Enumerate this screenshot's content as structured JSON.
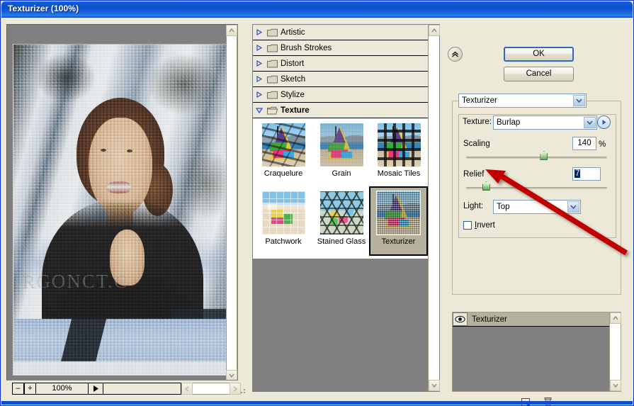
{
  "window": {
    "title": "Texturizer (100%)"
  },
  "preview": {
    "zoom_label": "100%",
    "zoom_out_label": "–",
    "zoom_in_label": "+",
    "watermark": "RGONCT.C",
    "scroll_up_icon": "chevron-up-icon",
    "scroll_down_icon": "chevron-down-icon",
    "scroll_left_icon": "chevron-left-icon",
    "scroll_right_icon": "chevron-right-icon",
    "preview_toggle_icon": "play-triangle-icon"
  },
  "filter_list": {
    "categories": [
      {
        "label": "Artistic",
        "expanded": false
      },
      {
        "label": "Brush Strokes",
        "expanded": false
      },
      {
        "label": "Distort",
        "expanded": false
      },
      {
        "label": "Sketch",
        "expanded": false
      },
      {
        "label": "Stylize",
        "expanded": false
      },
      {
        "label": "Texture",
        "expanded": true
      }
    ],
    "thumbnails": [
      {
        "label": "Craquelure",
        "selected": false
      },
      {
        "label": "Grain",
        "selected": false
      },
      {
        "label": "Mosaic Tiles",
        "selected": false
      },
      {
        "label": "Patchwork",
        "selected": false
      },
      {
        "label": "Stained Glass",
        "selected": false
      },
      {
        "label": "Texturizer",
        "selected": true
      }
    ]
  },
  "buttons": {
    "ok": "OK",
    "cancel": "Cancel",
    "collapse_icon": "double-chevron-up-icon"
  },
  "settings": {
    "filter_name": "Texturizer",
    "texture_label": "Texture:",
    "texture_value": "Burlap",
    "load_texture_icon": "right-triangle-circle-icon",
    "scaling_label": "Scaling",
    "scaling_value": "140",
    "scaling_unit": "%",
    "scaling_percent_pos": 55,
    "relief_label": "Relief",
    "relief_value": "7",
    "relief_percent_pos": 14,
    "light_label": "Light:",
    "light_value": "Top",
    "invert_label_prefix": "I",
    "invert_label_rest": "nvert",
    "invert_checked": false
  },
  "effects_panel": {
    "layer_name": "Texturizer",
    "visibility_icon": "eye-icon",
    "new_layer_icon": "new-effect-layer-icon",
    "delete_layer_icon": "trash-icon"
  },
  "colors": {
    "titlebar_blue": "#0a4fcc",
    "dialog_face": "#ece9d8",
    "selected_thumb": "#b5b19c",
    "arrow_red": "#c00000",
    "slider_green": "#5fa54f"
  }
}
